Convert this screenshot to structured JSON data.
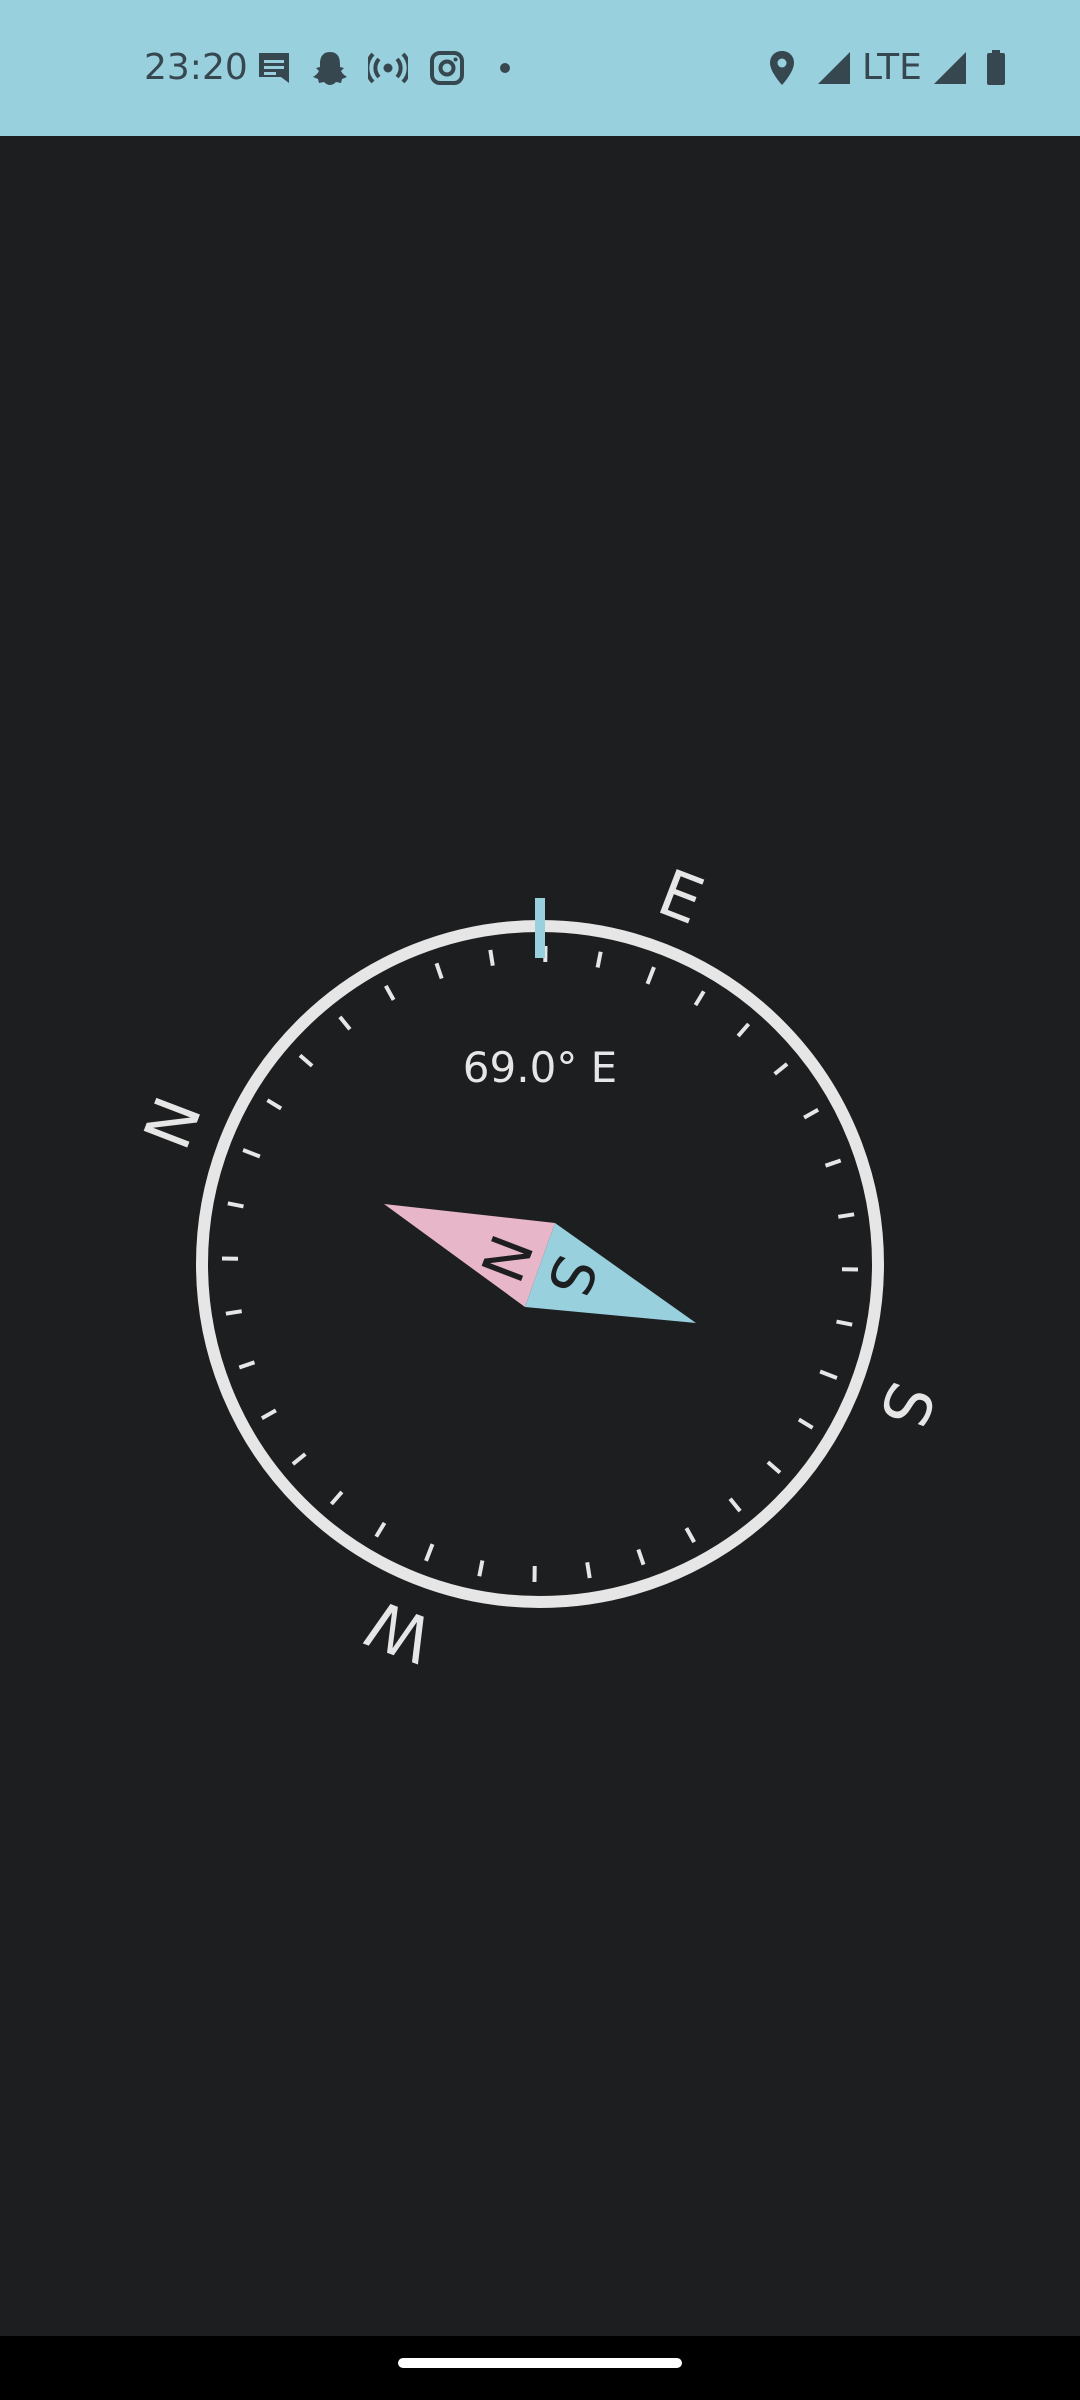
{
  "status_bar": {
    "time": "23:20",
    "left_icons": [
      "message-icon",
      "snapchat-icon",
      "hotspot-icon",
      "instagram-icon",
      "dot-icon"
    ],
    "right_icons": [
      "location-icon",
      "signal-icon",
      "signal-icon",
      "battery-icon"
    ],
    "network": "LTE",
    "background_color": "#98d0de",
    "icon_color": "#37474f"
  },
  "compass": {
    "heading": "69.0° E",
    "heading_degrees": 69.0,
    "cardinals": {
      "north": "N",
      "east": "E",
      "south": "S",
      "west": "W"
    },
    "needle_north_label": "N",
    "needle_south_label": "S",
    "needle_north_color": "#e8b6c9",
    "needle_south_color": "#98d0de",
    "indicator_color": "#98d0de",
    "dial_color": "#e6e6e6"
  },
  "colors": {
    "background": "#1d1e20",
    "nav_bar": "#000000"
  }
}
